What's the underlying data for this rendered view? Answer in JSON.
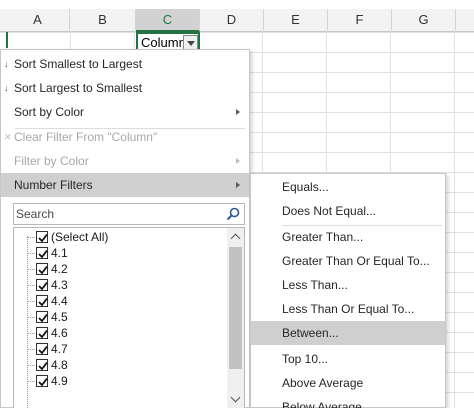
{
  "sheet": {
    "columns": [
      "A",
      "B",
      "C",
      "D",
      "E",
      "F",
      "G"
    ],
    "selected_column": "C",
    "header_cell_text": "Column"
  },
  "sort_menu": {
    "items": [
      {
        "label": "Sort Smallest to Largest",
        "enabled": true
      },
      {
        "label": "Sort Largest to Smallest",
        "enabled": true
      },
      {
        "label": "Sort by Color",
        "enabled": true,
        "submenu": true
      },
      {
        "label": "Clear Filter From \"Column\"",
        "enabled": false
      },
      {
        "label": "Filter by Color",
        "enabled": false,
        "submenu": true
      },
      {
        "label": "Number Filters",
        "enabled": true,
        "submenu": true,
        "active": true
      }
    ]
  },
  "search": {
    "placeholder": "Search",
    "value": ""
  },
  "values_list": [
    {
      "label": "(Select All)",
      "checked": true
    },
    {
      "label": "4.1",
      "checked": true
    },
    {
      "label": "4.2",
      "checked": true
    },
    {
      "label": "4.3",
      "checked": true
    },
    {
      "label": "4.4",
      "checked": true
    },
    {
      "label": "4.5",
      "checked": true
    },
    {
      "label": "4.6",
      "checked": true
    },
    {
      "label": "4.7",
      "checked": true
    },
    {
      "label": "4.8",
      "checked": true
    },
    {
      "label": "4.9",
      "checked": true
    }
  ],
  "number_filters": {
    "items": [
      {
        "label": "Equals..."
      },
      {
        "label": "Does Not Equal..."
      },
      {
        "label": "Greater Than..."
      },
      {
        "label": "Greater Than Or Equal To..."
      },
      {
        "label": "Less Than..."
      },
      {
        "label": "Less Than Or Equal To..."
      },
      {
        "label": "Between...",
        "active": true
      },
      {
        "label": "Top 10..."
      },
      {
        "label": "Above Average"
      },
      {
        "label": "Below Average"
      }
    ]
  },
  "colors": {
    "accent_green": "#217346",
    "highlight": "#cfcfcf",
    "disabled_text": "#a8a8a8"
  }
}
